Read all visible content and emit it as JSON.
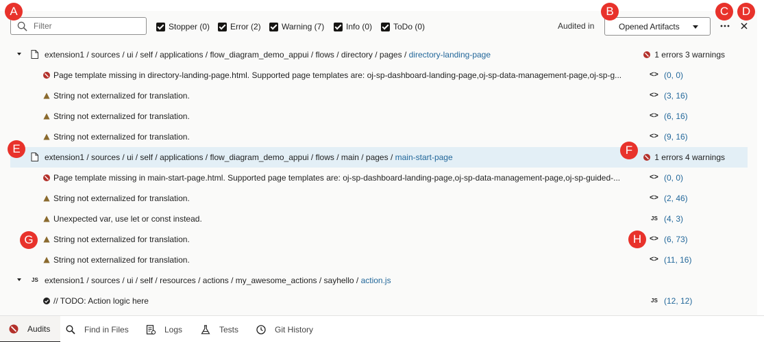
{
  "toolbar": {
    "filter_placeholder": "Filter",
    "checkboxes": [
      {
        "label": "Stopper (0)",
        "checked": true
      },
      {
        "label": "Error (2)",
        "checked": true
      },
      {
        "label": "Warning (7)",
        "checked": true
      },
      {
        "label": "Info (0)",
        "checked": true
      },
      {
        "label": "ToDo (0)",
        "checked": true
      }
    ],
    "audited_in_label": "Audited in",
    "audited_in_value": "Opened Artifacts",
    "more_label": "···",
    "close_label": "×"
  },
  "files": [
    {
      "path_prefix": "extension1 / sources / ui / self / applications / flow_diagram_demo_appui / flows / directory / pages / ",
      "path_link": "directory-landing-page",
      "summary": "1 errors 3 warnings",
      "issues": [
        {
          "severity": "error",
          "message": "Page template missing in directory-landing-page.html. Supported page templates are: oj-sp-dashboard-landing-page,oj-sp-data-management-page,oj-sp-g...",
          "kind": "<>",
          "location": "(0, 0)"
        },
        {
          "severity": "warning",
          "message": "String not externalized for translation.",
          "kind": "<>",
          "location": "(3, 16)"
        },
        {
          "severity": "warning",
          "message": "String not externalized for translation.",
          "kind": "<>",
          "location": "(6, 16)"
        },
        {
          "severity": "warning",
          "message": "String not externalized for translation.",
          "kind": "<>",
          "location": "(9, 16)"
        }
      ]
    },
    {
      "path_prefix": "extension1 / sources / ui / self / applications / flow_diagram_demo_appui / flows / main / pages / ",
      "path_link": "main-start-page",
      "summary": "1 errors 4 warnings",
      "issues": [
        {
          "severity": "error",
          "message": "Page template missing in main-start-page.html. Supported page templates are: oj-sp-dashboard-landing-page,oj-sp-data-management-page,oj-sp-guided-...",
          "kind": "<>",
          "location": "(0, 0)"
        },
        {
          "severity": "warning",
          "message": "String not externalized for translation.",
          "kind": "<>",
          "location": "(2, 46)"
        },
        {
          "severity": "warning",
          "message": "Unexpected var, use let or const instead.",
          "kind": "JS",
          "location": "(4, 3)"
        },
        {
          "severity": "warning",
          "message": "String not externalized for translation.",
          "kind": "<>",
          "location": "(6, 73)"
        },
        {
          "severity": "warning",
          "message": "String not externalized for translation.",
          "kind": "<>",
          "location": "(11, 16)"
        }
      ]
    },
    {
      "path_prefix": "extension1 / sources / ui / self / resources / actions / my_awesome_actions / sayhello / ",
      "path_link": "action.js",
      "issues": [
        {
          "severity": "todo",
          "message": "// TODO: Action logic here",
          "kind": "JS",
          "location": "(12, 12)"
        }
      ]
    }
  ],
  "file_icons": [
    "file-icon",
    "file-icon",
    "js-file-icon"
  ],
  "js_badge": "JS",
  "tabs": [
    {
      "label": "Audits",
      "icon": "audits-icon",
      "active": true
    },
    {
      "label": "Find in Files",
      "icon": "search-icon",
      "active": false
    },
    {
      "label": "Logs",
      "icon": "logs-icon",
      "active": false
    },
    {
      "label": "Tests",
      "icon": "flask-icon",
      "active": false
    },
    {
      "label": "Git History",
      "icon": "history-icon",
      "active": false
    }
  ],
  "callouts": [
    "A",
    "B",
    "C",
    "D",
    "E",
    "F",
    "G",
    "H"
  ],
  "colors": {
    "error": "#b3312b",
    "warning": "#8a6a2e",
    "link": "#22679a",
    "selected_row": "#e3eff6",
    "callout": "#e8322b"
  }
}
